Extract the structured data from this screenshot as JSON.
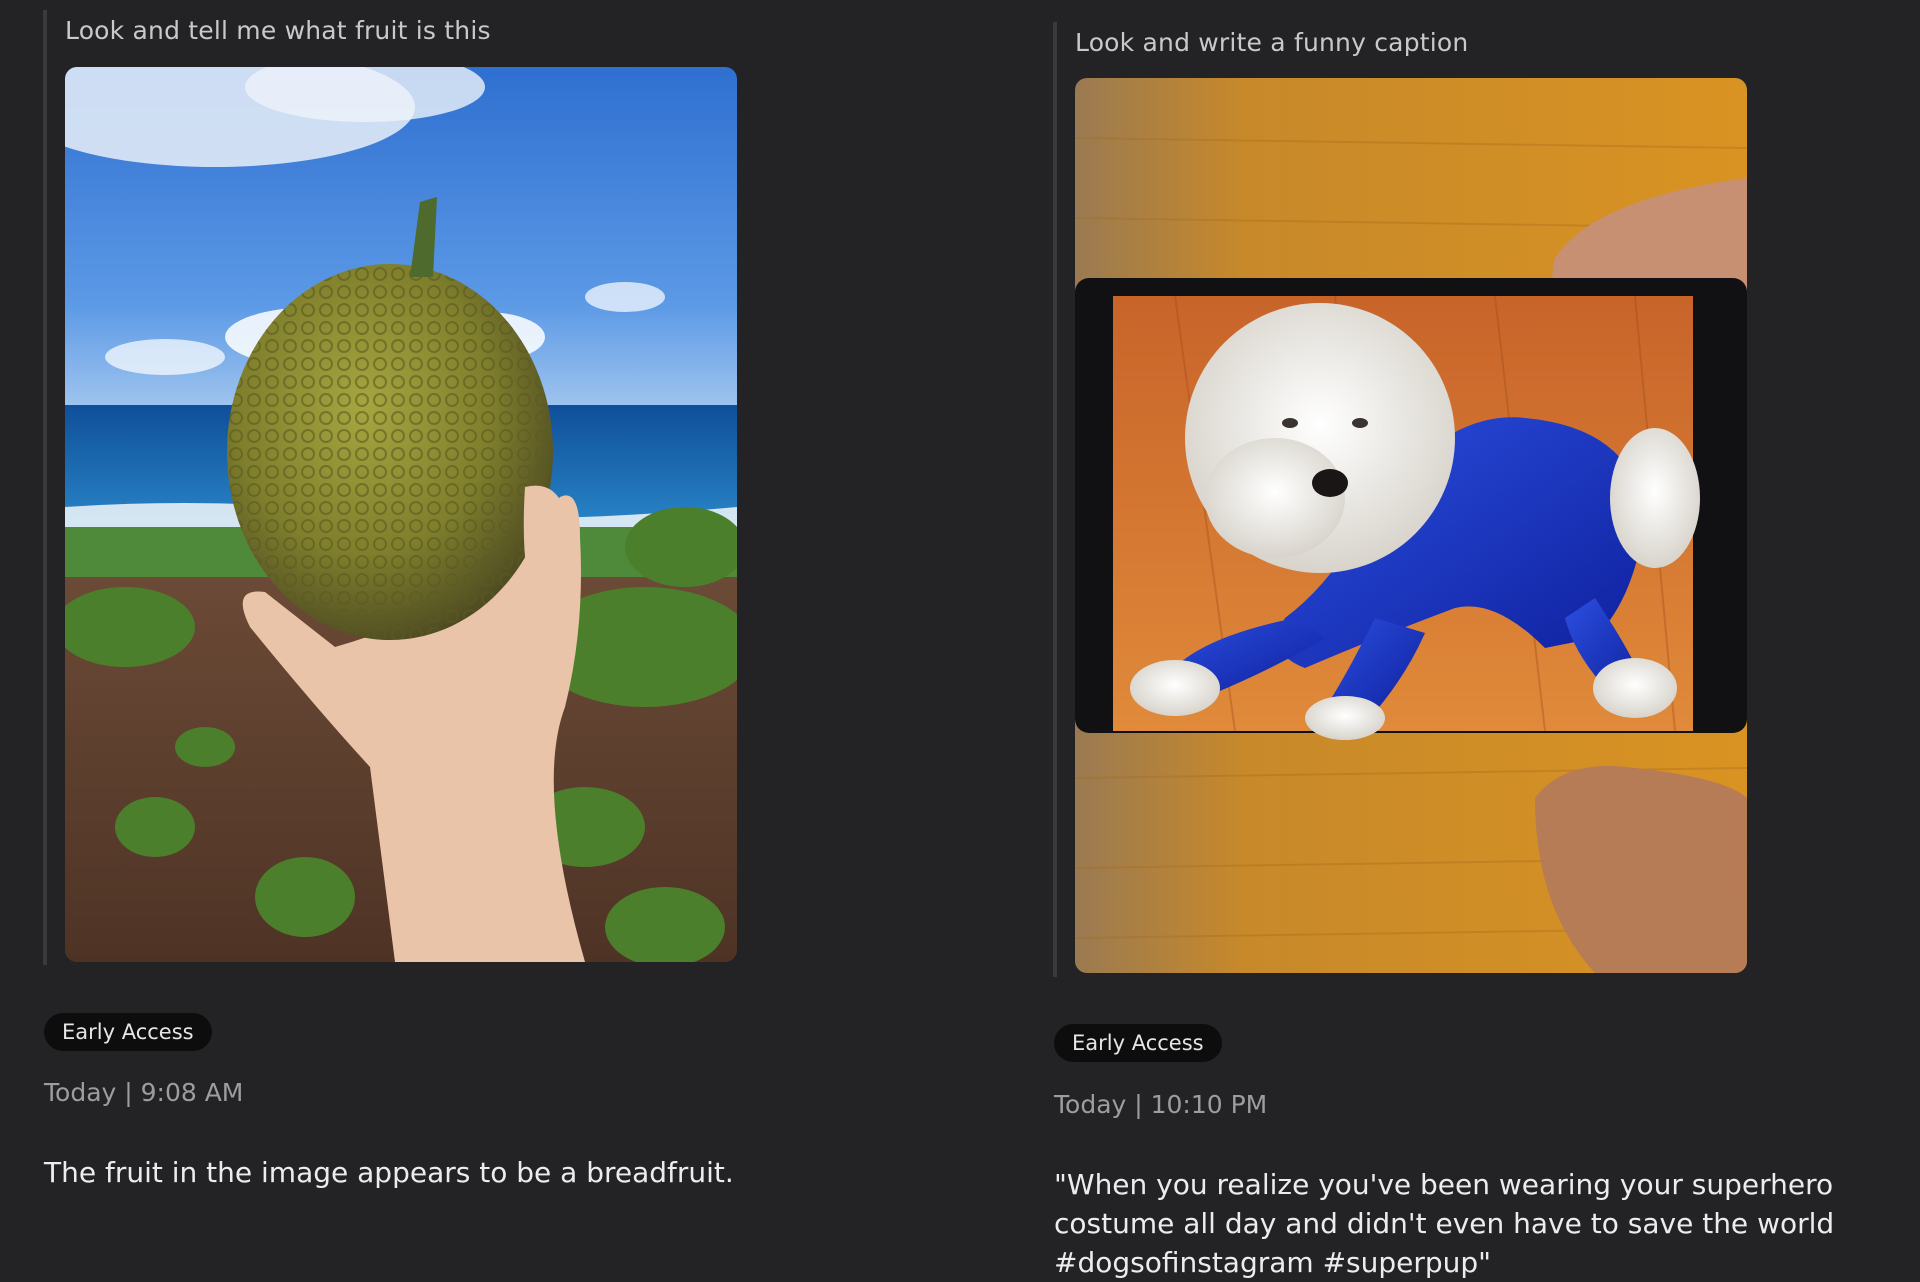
{
  "left_card": {
    "prompt": "Look and tell me what fruit is this",
    "badge": "Early Access",
    "timestamp": "Today | 9:08 AM",
    "answer": "The fruit in the image appears to be a breadfruit."
  },
  "right_card": {
    "prompt": "Look and write a funny caption",
    "badge": "Early Access",
    "timestamp": "Today | 10:10 PM",
    "answer": "\"When you realize you've been wearing your superhero costume all day and didn't even have to save the world #dogsofinstagram #superpup\""
  },
  "colors": {
    "background": "#232325",
    "quote_bar": "#3a3a3d",
    "badge_bg": "#0d0d0e",
    "prompt_text": "#c9c9cc",
    "timestamp_text": "#9d9da1",
    "answer_text": "#ececee"
  }
}
